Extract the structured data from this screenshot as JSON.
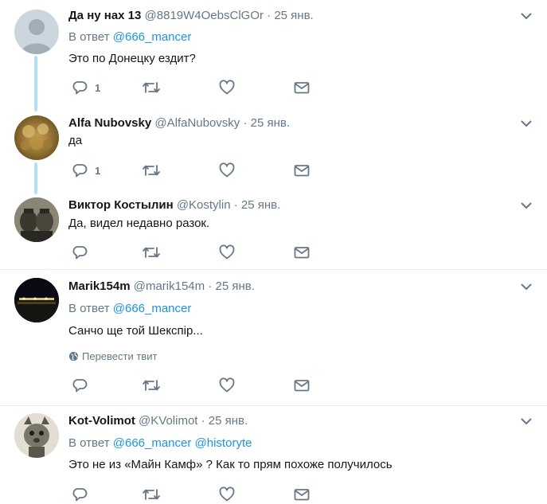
{
  "tweets": [
    {
      "name": "Да ну нах 13",
      "handle": "@8819W4OebsClGOr",
      "date": "· 25 янв.",
      "reply_prefix": "В ответ",
      "reply_handles": "@666_mancer",
      "text": "Это по Донецку ездит?",
      "reply_count": "1"
    },
    {
      "name": "Alfa Nubovsky",
      "handle": "@AlfaNubovsky",
      "date": "· 25 янв.",
      "text": "да",
      "reply_count": "1"
    },
    {
      "name": "Виктор Костылин",
      "handle": "@Kostylin",
      "date": "· 25 янв.",
      "text": "Да, видел недавно разок."
    },
    {
      "name": "Marik154m",
      "handle": "@marik154m",
      "date": "· 25 янв.",
      "reply_prefix": "В ответ",
      "reply_handles": "@666_mancer",
      "text": "Санчо ще той Шекспір...",
      "translate_label": "Перевести твит"
    },
    {
      "name": "Kot-Volimot",
      "handle": "@KVolimot",
      "date": "· 25 янв.",
      "reply_prefix": "В ответ",
      "reply_handles": "@666_mancer @historyte",
      "text": "Это не из «Майн Камф» ? Как то прям похоже получилось"
    }
  ],
  "colors": {
    "link": "#1b95e0",
    "secondary_text": "#657786",
    "icon": "#657786",
    "thread_line": "#b3e0f7",
    "separator": "#e6ecf0"
  },
  "icons": [
    "reply-icon",
    "retweet-icon",
    "like-icon",
    "direct-message-icon",
    "chevron-down-icon",
    "globe-icon"
  ]
}
